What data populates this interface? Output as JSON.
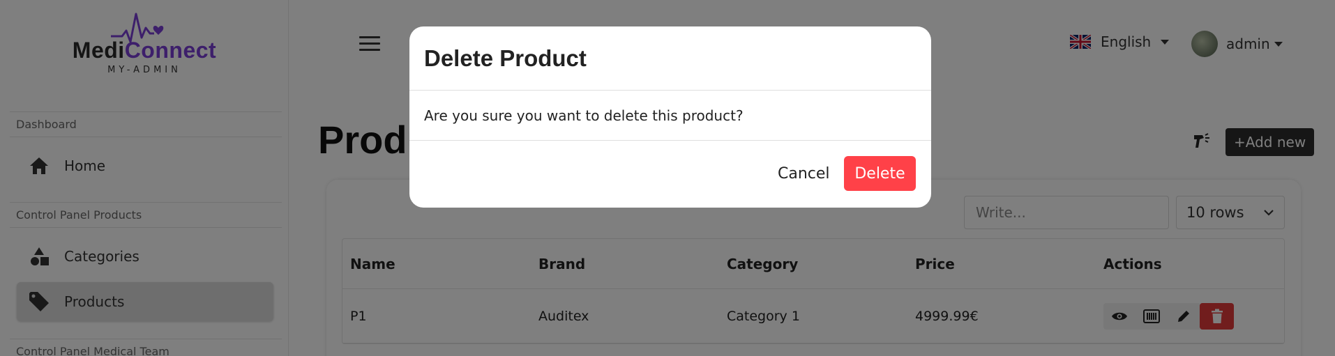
{
  "sidebar": {
    "logo": {
      "part1": "Medi",
      "part2": "Connect",
      "subtitle": "MY-ADMIN"
    },
    "sections": [
      {
        "label": "Dashboard"
      },
      {
        "label": "Control Panel Products"
      },
      {
        "label": "Control Panel Medical Team"
      }
    ],
    "items": [
      {
        "label": "Home",
        "icon": "home-icon"
      },
      {
        "label": "Categories",
        "icon": "shapes-icon"
      },
      {
        "label": "Products",
        "icon": "tag-icon",
        "active": true
      }
    ]
  },
  "header": {
    "language": {
      "label": "English",
      "icon": "uk-flag-icon"
    },
    "user": {
      "name": "admin"
    }
  },
  "page": {
    "title": "Products",
    "add_button": "+Add new"
  },
  "table_controls": {
    "search_placeholder": "Write...",
    "rows_select": "10 rows"
  },
  "table": {
    "columns": [
      "Name",
      "Brand",
      "Category",
      "Price",
      "Actions"
    ],
    "rows": [
      {
        "name": "P1",
        "brand": "Auditex",
        "category": "Category 1",
        "price": "4999.99€"
      }
    ],
    "action_icons": [
      "eye-icon",
      "barcode-icon",
      "pencil-icon",
      "trash-icon"
    ]
  },
  "modal": {
    "title": "Delete Product",
    "message": "Are you sure you want to delete this product?",
    "cancel_label": "Cancel",
    "delete_label": "Delete"
  },
  "colors": {
    "brand_purple": "#7a3fd6",
    "delete_red": "#ff4148",
    "overlay": "rgba(0,0,0,0.5)"
  }
}
